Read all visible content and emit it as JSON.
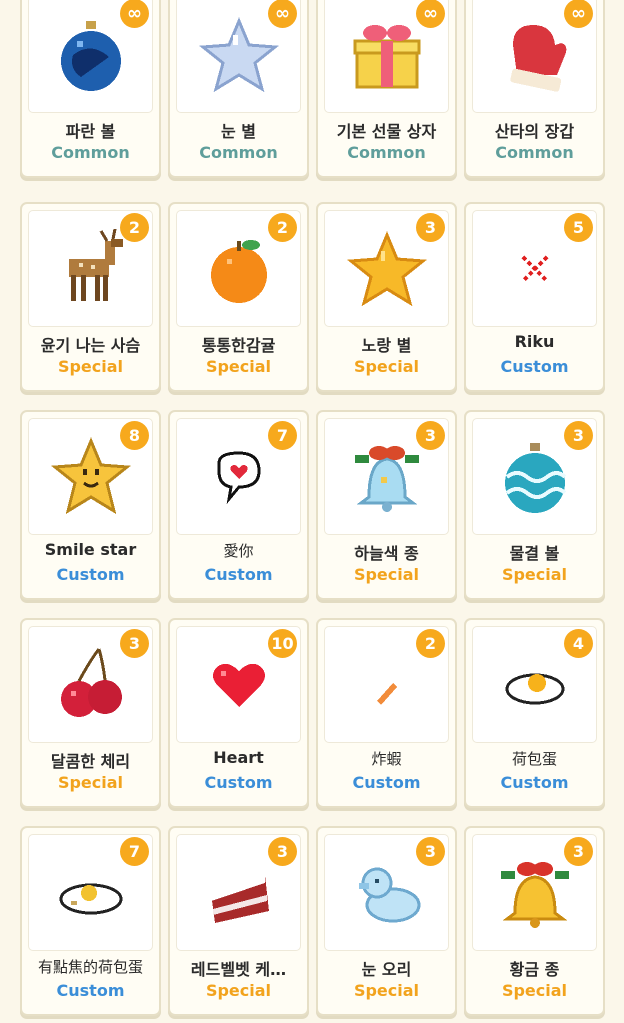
{
  "colors": {
    "common": "#5f9e9b",
    "special": "#f2a31d",
    "custom": "#3b8ed8",
    "badge": "#f7a91d"
  },
  "items": [
    {
      "name": "파란 볼",
      "rarity": "Common",
      "count": "∞",
      "icon": "blue-ornament-icon"
    },
    {
      "name": "눈 별",
      "rarity": "Common",
      "count": "∞",
      "icon": "snow-star-icon"
    },
    {
      "name": "기본 선물 상자",
      "rarity": "Common",
      "count": "∞",
      "icon": "gift-box-icon"
    },
    {
      "name": "산타의 장갑",
      "rarity": "Common",
      "count": "∞",
      "icon": "santa-mitten-icon"
    },
    {
      "name": "윤기 나는 사슴",
      "rarity": "Special",
      "count": "2",
      "icon": "deer-icon"
    },
    {
      "name": "통통한감귤",
      "rarity": "Special",
      "count": "2",
      "icon": "tangerine-icon"
    },
    {
      "name": "노랑 별",
      "rarity": "Special",
      "count": "3",
      "icon": "yellow-star-icon"
    },
    {
      "name": "Riku",
      "rarity": "Custom",
      "count": "5",
      "icon": "red-x-icon"
    },
    {
      "name": "Smile star",
      "rarity": "Custom",
      "count": "8",
      "icon": "smile-star-icon"
    },
    {
      "name": "愛你",
      "rarity": "Custom",
      "count": "7",
      "icon": "heart-speech-bubble-icon"
    },
    {
      "name": "하늘색 종",
      "rarity": "Special",
      "count": "3",
      "icon": "sky-blue-bell-icon"
    },
    {
      "name": "물결 볼",
      "rarity": "Special",
      "count": "3",
      "icon": "wave-ornament-icon"
    },
    {
      "name": "달콤한 체리",
      "rarity": "Special",
      "count": "3",
      "icon": "cherry-icon"
    },
    {
      "name": "Heart",
      "rarity": "Custom",
      "count": "10",
      "icon": "heart-icon"
    },
    {
      "name": "炸蝦",
      "rarity": "Custom",
      "count": "2",
      "icon": "fried-shrimp-icon"
    },
    {
      "name": "荷包蛋",
      "rarity": "Custom",
      "count": "4",
      "icon": "fried-egg-icon"
    },
    {
      "name": "有點焦的荷包蛋",
      "rarity": "Custom",
      "count": "7",
      "icon": "burnt-fried-egg-icon"
    },
    {
      "name": "레드벨벳 케…",
      "rarity": "Special",
      "count": "3",
      "icon": "red-velvet-cake-icon"
    },
    {
      "name": "눈 오리",
      "rarity": "Special",
      "count": "3",
      "icon": "snow-duck-icon"
    },
    {
      "name": "황금 종",
      "rarity": "Special",
      "count": "3",
      "icon": "golden-bell-icon"
    }
  ]
}
